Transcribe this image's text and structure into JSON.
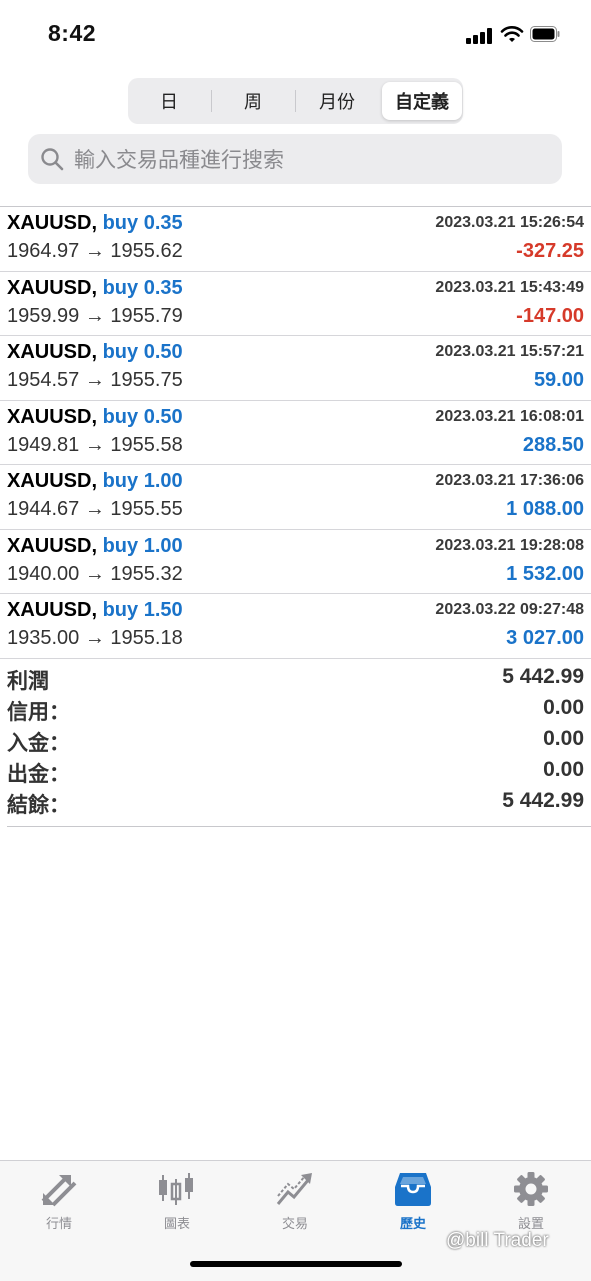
{
  "status": {
    "time": "8:42"
  },
  "segments": {
    "day": "日",
    "week": "周",
    "month": "月份",
    "custom": "自定義",
    "selected": "自定義"
  },
  "search": {
    "placeholder": "輸入交易品種進行搜索"
  },
  "deals": [
    {
      "symbol": "XAUUSD,",
      "side": "buy 0.35",
      "datetime": "2023.03.21 15:26:54",
      "open": "1964.97",
      "arrow": "→",
      "close": "1955.62",
      "profit": "-327.25",
      "color": "#d63a2a"
    },
    {
      "symbol": "XAUUSD,",
      "side": "buy 0.35",
      "datetime": "2023.03.21 15:43:49",
      "open": "1959.99",
      "arrow": "→",
      "close": "1955.79",
      "profit": "-147.00",
      "color": "#d63a2a"
    },
    {
      "symbol": "XAUUSD,",
      "side": "buy 0.50",
      "datetime": "2023.03.21 15:57:21",
      "open": "1954.57",
      "arrow": "→",
      "close": "1955.75",
      "profit": "59.00",
      "color": "#1a73c9"
    },
    {
      "symbol": "XAUUSD,",
      "side": "buy 0.50",
      "datetime": "2023.03.21 16:08:01",
      "open": "1949.81",
      "arrow": "→",
      "close": "1955.58",
      "profit": "288.50",
      "color": "#1a73c9"
    },
    {
      "symbol": "XAUUSD,",
      "side": "buy 1.00",
      "datetime": "2023.03.21 17:36:06",
      "open": "1944.67",
      "arrow": "→",
      "close": "1955.55",
      "profit": "1 088.00",
      "color": "#1a73c9"
    },
    {
      "symbol": "XAUUSD,",
      "side": "buy 1.00",
      "datetime": "2023.03.21 19:28:08",
      "open": "1940.00",
      "arrow": "→",
      "close": "1955.32",
      "profit": "1 532.00",
      "color": "#1a73c9"
    },
    {
      "symbol": "XAUUSD,",
      "side": "buy 1.50",
      "datetime": "2023.03.22 09:27:48",
      "open": "1935.00",
      "arrow": "→",
      "close": "1955.18",
      "profit": "3 027.00",
      "color": "#1a73c9"
    }
  ],
  "summary": {
    "profit_label": "利潤",
    "profit_value": "5 442.99",
    "credit_label": "信用：",
    "credit_value": "0.00",
    "deposit_label": "入金：",
    "deposit_value": "0.00",
    "withdrawal_label": "出金：",
    "withdrawal_value": "0.00",
    "balance_label": "結餘：",
    "balance_value": "5 442.99"
  },
  "tabs": {
    "quotes": "行情",
    "charts": "圖表",
    "trade": "交易",
    "history": "歷史",
    "settings": "設置",
    "active": "歷史"
  },
  "colors": {
    "accent": "#1a73c9",
    "loss": "#d63a2a",
    "inactive": "#8e8e93"
  },
  "icons": [
    "quotes-arrows-icon",
    "candlestick-chart-icon",
    "trade-trend-icon",
    "history-tray-icon",
    "gear-icon"
  ],
  "watermark": "@bill Trader"
}
